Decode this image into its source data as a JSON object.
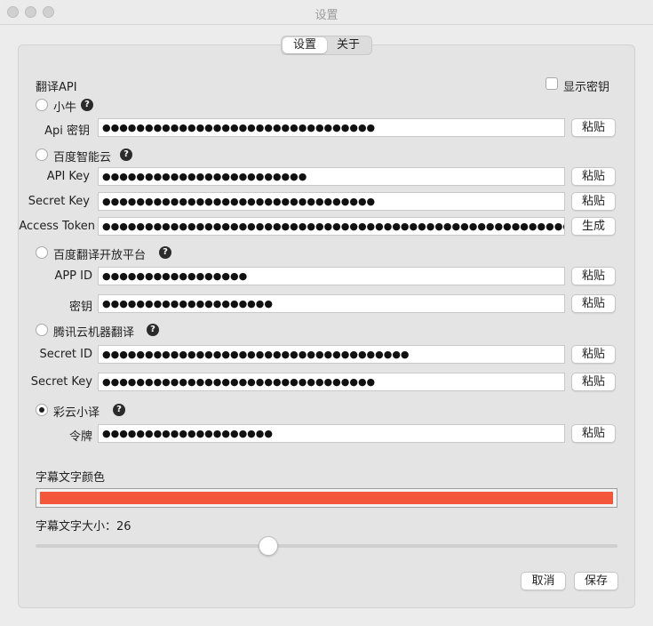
{
  "window": {
    "title": "设置"
  },
  "tabs": [
    {
      "label": "设置"
    },
    {
      "label": "关于"
    }
  ],
  "section_title": "翻译API",
  "show_secret": {
    "label": "显示密钥",
    "checked": false
  },
  "providers": [
    {
      "name": "小牛",
      "selected": false,
      "fields": [
        {
          "label": "Api 密钥",
          "value": "●●●●●●●●●●●●●●●●●●●●●●●●●●●●●●●●",
          "button": "粘贴"
        }
      ]
    },
    {
      "name": "百度智能云",
      "selected": false,
      "fields": [
        {
          "label": "API Key",
          "value": "●●●●●●●●●●●●●●●●●●●●●●●●",
          "button": "粘贴"
        },
        {
          "label": "Secret Key",
          "value": "●●●●●●●●●●●●●●●●●●●●●●●●●●●●●●●●",
          "button": "粘贴"
        },
        {
          "label": "Access Token",
          "value": "●●●●●●●●●●●●●●●●●●●●●●●●●●●●●●●●●●●●●●●●●●●●●●●●●●●●●●●●●●●●●●●●●●●●●●●●●●●●●●",
          "button": "生成"
        }
      ]
    },
    {
      "name": "百度翻译开放平台",
      "selected": false,
      "fields": [
        {
          "label": "APP ID",
          "value": "●●●●●●●●●●●●●●●●●",
          "button": "粘贴"
        },
        {
          "label": "密钥",
          "value": "●●●●●●●●●●●●●●●●●●●●",
          "button": "粘贴"
        }
      ]
    },
    {
      "name": "腾讯云机器翻译",
      "selected": false,
      "fields": [
        {
          "label": "Secret ID",
          "value": "●●●●●●●●●●●●●●●●●●●●●●●●●●●●●●●●●●●●",
          "button": "粘贴"
        },
        {
          "label": "Secret Key",
          "value": "●●●●●●●●●●●●●●●●●●●●●●●●●●●●●●●●",
          "button": "粘贴"
        }
      ]
    },
    {
      "name": "彩云小译",
      "selected": true,
      "fields": [
        {
          "label": "令牌",
          "value": "●●●●●●●●●●●●●●●●●●●●",
          "button": "粘贴"
        }
      ]
    }
  ],
  "help_glyph": "?",
  "subtitle_color": {
    "label": "字幕文字颜色",
    "value": "#f4563a"
  },
  "subtitle_size": {
    "label": "字幕文字大小：",
    "value": "26",
    "slider_fraction": 0.4
  },
  "actions": {
    "cancel": "取消",
    "save": "保存"
  }
}
